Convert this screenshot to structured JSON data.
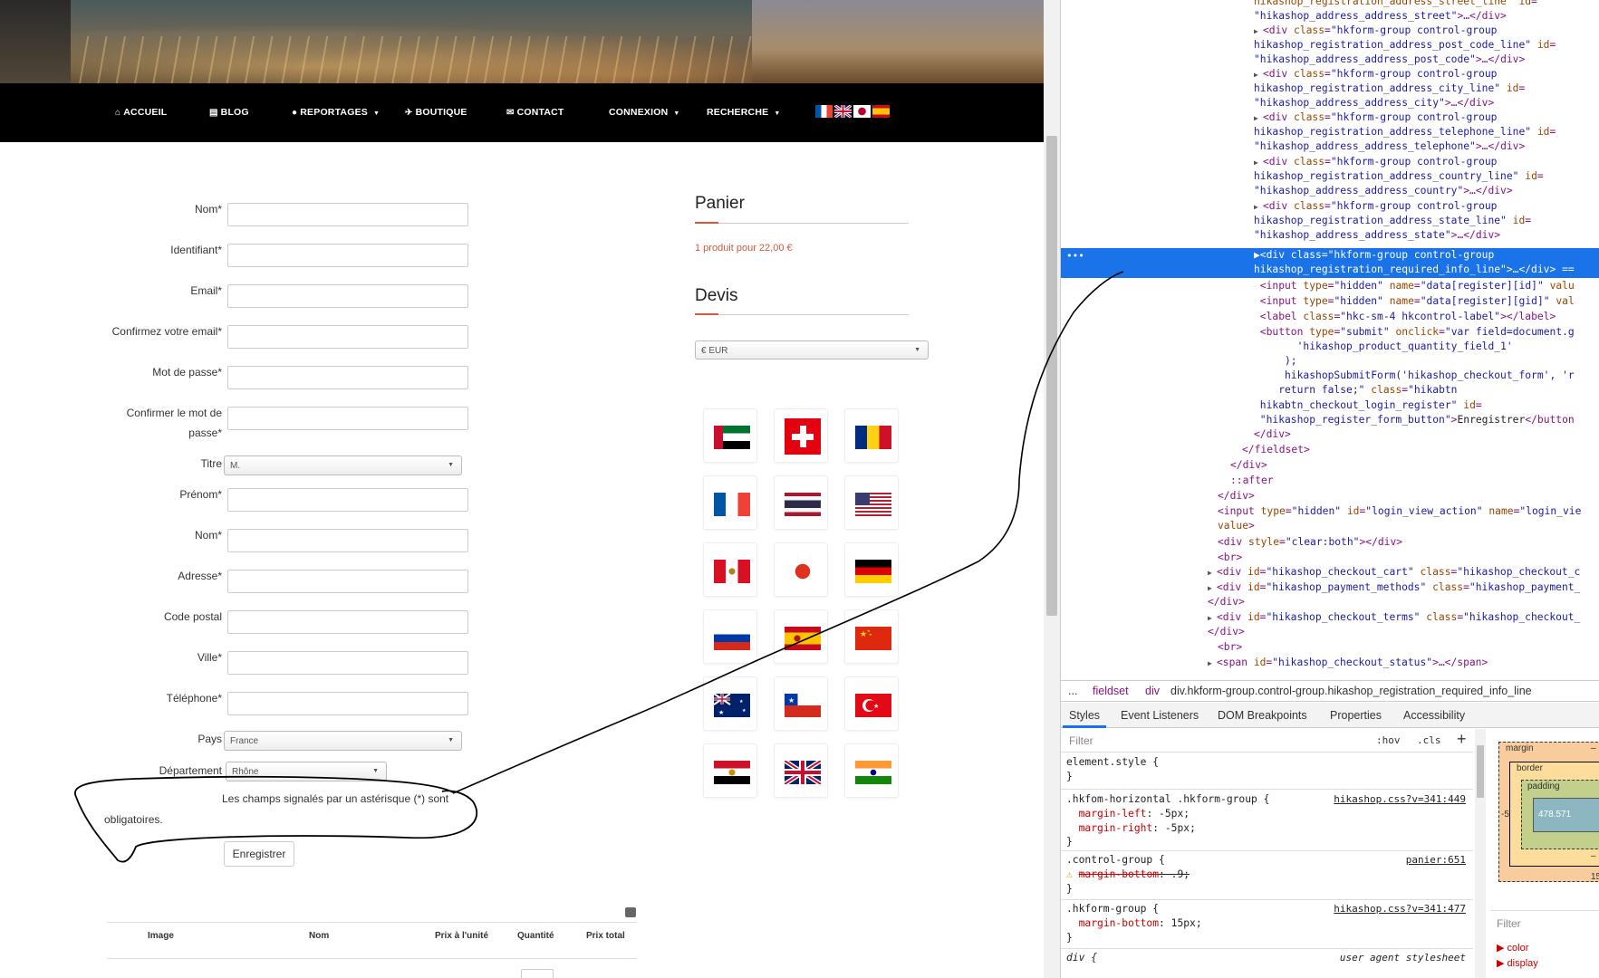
{
  "site": {
    "nav": [
      {
        "icon": "⌂",
        "label": "ACCUEIL",
        "caret": false
      },
      {
        "icon": "▤",
        "label": "BLOG",
        "caret": false
      },
      {
        "icon": "●",
        "label": "REPORTAGES",
        "caret": true
      },
      {
        "icon": "✈",
        "label": "BOUTIQUE",
        "caret": false
      },
      {
        "icon": "✉",
        "label": "CONTACT",
        "caret": false
      },
      {
        "icon": "",
        "label": "CONNEXION",
        "caret": true
      },
      {
        "icon": "",
        "label": "RECHERCHE",
        "caret": true
      }
    ],
    "form": {
      "nom": "Nom*",
      "identifiant": "Identifiant*",
      "email": "Email*",
      "confirm_email": "Confirmez votre email*",
      "password": "Mot de passe*",
      "confirm_password_1": "Confirmer le mot de",
      "confirm_password_2": "passe*",
      "titre": "Titre",
      "titre_value": "M.",
      "prenom": "Prénom*",
      "nom2": "Nom*",
      "adresse": "Adresse*",
      "code_postal": "Code postal",
      "ville": "Ville*",
      "telephone": "Téléphone*",
      "pays": "Pays",
      "pays_value": "France",
      "departement": "Département",
      "departement_value": "Rhône",
      "required_note_1": "Les champs signalés par un astérisque (*) sont",
      "required_note_2": "obligatoires.",
      "register_button": "Enregistrer"
    },
    "cart_table": {
      "headers": [
        "Image",
        "Nom",
        "Prix à l'unité",
        "Quantité",
        "Prix total"
      ]
    },
    "panier": {
      "title": "Panier",
      "summary": "1 produit pour 22,00 €"
    },
    "devis": {
      "title": "Devis",
      "currency_value": "€ EUR"
    },
    "currency_flags": [
      "uae-flag-icon",
      "switzerland-flag-icon",
      "romania-flag-icon",
      "france-flag-icon",
      "thailand-flag-icon",
      "usa-flag-icon",
      "peru-flag-icon",
      "japan-flag-icon",
      "germany-flag-icon",
      "russia-flag-icon",
      "spain-flag-icon",
      "china-flag-icon",
      "australia-flag-icon",
      "chile-flag-icon",
      "turkey-flag-icon",
      "egypt-flag-icon",
      "uk-flag-icon",
      "india-flag-icon"
    ]
  },
  "devtools": {
    "breadcrumb": {
      "ellipsis": "...",
      "item1": "fieldset",
      "item2": "div",
      "item3": "div.hkform-group.control-group.hikashop_registration_required_info_line"
    },
    "tabs": [
      "Styles",
      "Event Listeners",
      "DOM Breakpoints",
      "Properties",
      "Accessibility"
    ],
    "filter_placeholder": "Filter",
    "hov": ":hov",
    "cls": ".cls",
    "rules": [
      {
        "selector": "element.style {",
        "source": ""
      },
      {
        "selector": ".hkfom-horizontal .hkform-group {",
        "source": "hikashop.css?v=341:449"
      },
      {
        "selector": ".control-group {",
        "source": "panier:651"
      },
      {
        "selector": ".hkform-group {",
        "source": "hikashop.css?v=341:477"
      },
      {
        "selector": "div {",
        "source": "user agent stylesheet"
      }
    ],
    "boxmodel": {
      "margin": "margin",
      "border": "border",
      "padding": "padding",
      "content": "478.571",
      "left_val": "-5",
      "dash": "–",
      "bottom": "15"
    },
    "computed": {
      "filter": "Filter",
      "props": [
        "color",
        "display"
      ]
    }
  }
}
